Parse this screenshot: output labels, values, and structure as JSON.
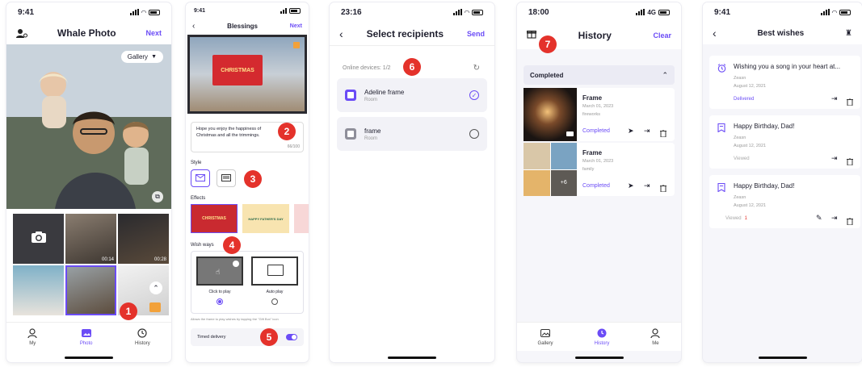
{
  "screen1": {
    "time": "9:41",
    "title": "Whale Photo",
    "next": "Next",
    "gallery": "Gallery",
    "thumbs": [
      "00:14",
      "00:28"
    ],
    "tabs": [
      "My",
      "Photo",
      "History"
    ],
    "badge": "1"
  },
  "screen2": {
    "time": "9:41",
    "title": "Blessings",
    "next": "Next",
    "card_text": "CHRISTMAS",
    "message": "Hope you enjoy the happiness of Christmas and all the trimmings.",
    "counter": "66/100",
    "style_label": "Style",
    "effects_label": "Effects",
    "effect_cards": [
      "CHRISTMAS",
      "HAPPY FATHER'S DAY"
    ],
    "wish_label": "Wish ways",
    "click_to_play": "Click to play",
    "auto_play": "Auto play",
    "hint": "Allows the frame to play wishes by tapping the \"Gift Box\" icon",
    "timed": "Timed delivery",
    "badges": [
      "2",
      "3",
      "4",
      "5"
    ]
  },
  "screen3": {
    "time": "23:16",
    "title": "Select recipients",
    "send": "Send",
    "online": "Online devices: 1/2",
    "devices": [
      {
        "name": "Adeline frame",
        "room": "Room",
        "selected": true
      },
      {
        "name": "frame",
        "room": "Room",
        "selected": false
      }
    ],
    "badge": "6"
  },
  "screen4": {
    "time": "18:00",
    "network": "4G",
    "title": "History",
    "clear": "Clear",
    "section": "Completed",
    "items": [
      {
        "title": "Frame",
        "date": "March 01, 2023",
        "tag": "fireworks",
        "status": "Completed"
      },
      {
        "title": "Frame",
        "date": "March 01, 2023",
        "tag": "family",
        "status": "Completed",
        "more": "+6"
      }
    ],
    "tabs": [
      "Gallery",
      "History",
      "Me"
    ],
    "badge": "7"
  },
  "screen5": {
    "time": "9:41",
    "title": "Best wishes",
    "wishes": [
      {
        "title": "Wishing you a song in your heart at...",
        "sender": "Zeasn",
        "date": "August 12, 2021",
        "status": "Delivered"
      },
      {
        "title": "Happy Birthday, Dad!",
        "sender": "Zeasn",
        "date": "August 12, 2021",
        "status": "Viewed"
      },
      {
        "title": "Happy Birthday, Dad!",
        "sender": "Zeasn",
        "date": "August 12, 2021",
        "status": "Viewed",
        "count": "1"
      }
    ]
  },
  "colors": {
    "accent": "#6b4cf6",
    "badge": "#e4322b"
  }
}
